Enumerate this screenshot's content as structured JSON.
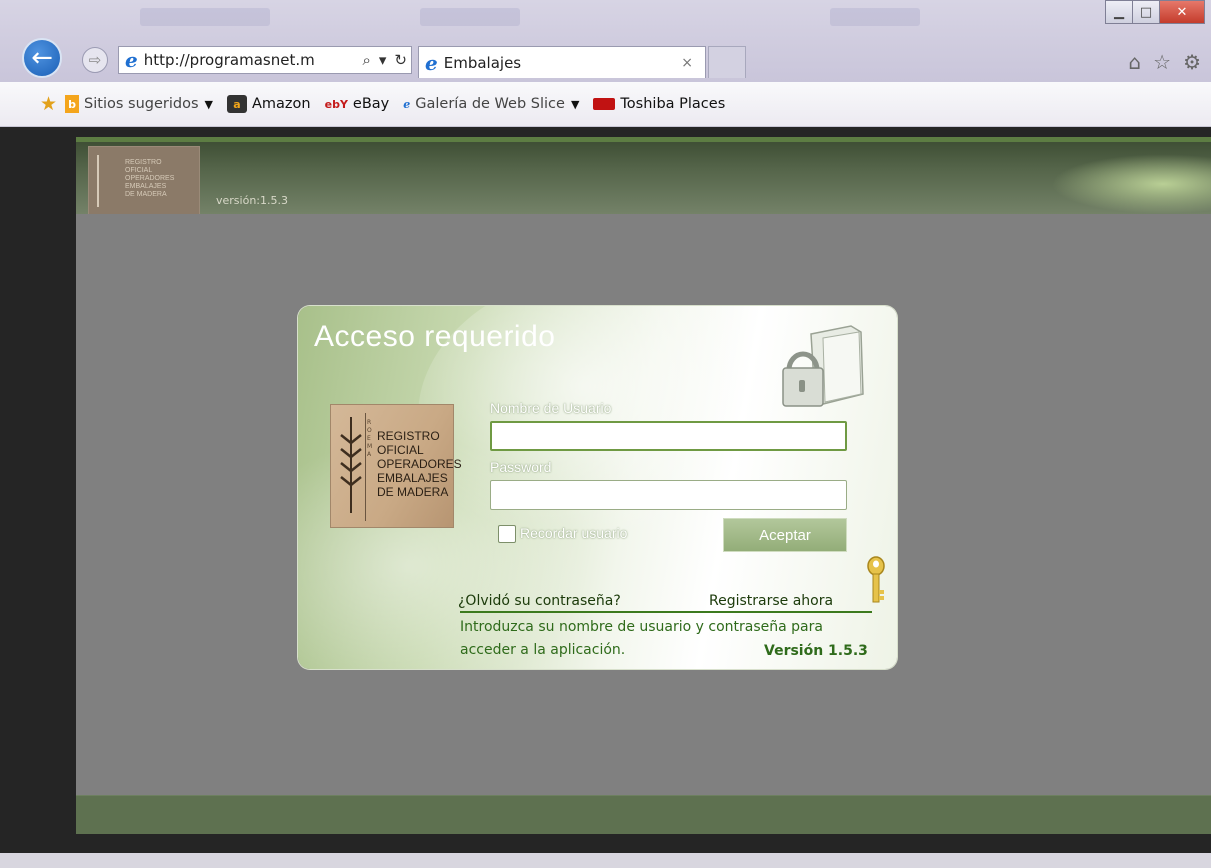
{
  "browser": {
    "address": "http://programasnet.m",
    "tab_title": "Embalajes",
    "tab_close": "×",
    "address_icons": {
      "search": "⌕",
      "dropdown": "▾",
      "refresh": "↻"
    },
    "window_controls": {
      "min": "▁",
      "max": "□",
      "close": "✕"
    },
    "tools_icons": [
      "home-icon",
      "favorites-star-icon",
      "gear-icon"
    ]
  },
  "favorites": [
    {
      "label": "Sitios sugeridos",
      "icon": "bing-icon",
      "dropdown": true
    },
    {
      "label": "Amazon",
      "icon": "amazon-icon",
      "dropdown": false
    },
    {
      "label": "eBay",
      "icon": "ebay-icon",
      "dropdown": false
    },
    {
      "label": "Galería de Web Slice",
      "icon": "ie-icon",
      "dropdown": true
    },
    {
      "label": "Toshiba Places",
      "icon": "toshiba-icon",
      "dropdown": false
    }
  ],
  "header": {
    "logo_lines": [
      "REGISTRO",
      "OFICIAL",
      "OPERADORES",
      "EMBALAJES",
      "DE MADERA"
    ],
    "version": "versión:1.5.3"
  },
  "login": {
    "title": "Acceso requerido",
    "logo_text": "REGISTRO\nOFICIAL\nOPERADORES\nEMBALAJES\nDE MADERA",
    "logo_letters": "ROEMA",
    "username_label": "Nombre de Usuario",
    "username_value": "",
    "password_label": "Password",
    "password_value": "",
    "remember_label": "Recordar usuario",
    "remember_checked": false,
    "accept_label": "Aceptar",
    "forgot_link": "¿Olvidó su contraseña?",
    "register_link": "Registrarse ahora",
    "info_text": "Introduzca su nombre de usuario y contraseña para acceder a la aplicación.",
    "version": "Versión 1.5.3"
  },
  "colors": {
    "accent_green": "#3c7a1e",
    "header_green": "#55654a",
    "ie_blue": "#1f6fd1"
  }
}
